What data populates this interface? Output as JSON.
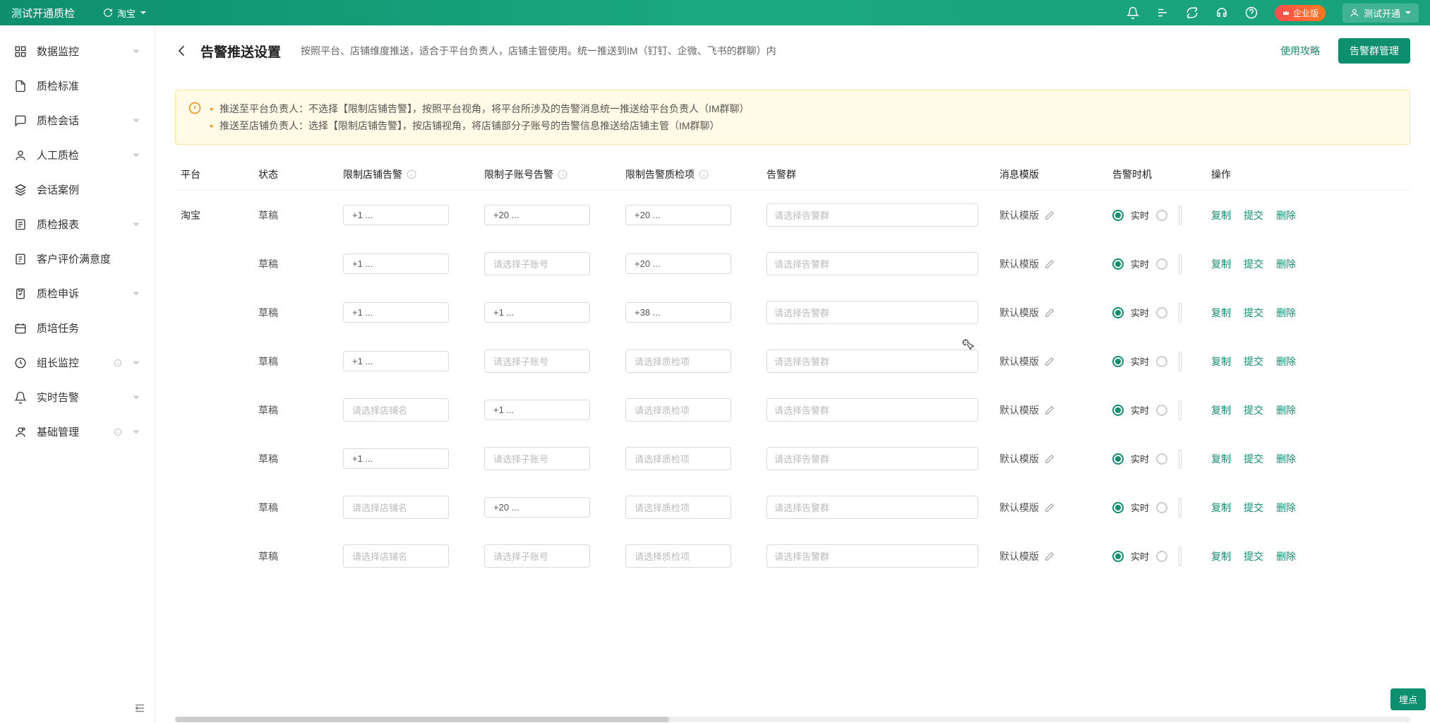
{
  "header": {
    "app_title": "测试开通质检",
    "platform_select": "淘宝",
    "enterprise_badge": "企业版",
    "user_label": "测试开通"
  },
  "sidebar": {
    "items": [
      {
        "label": "数据监控",
        "icon": "dashboard-icon",
        "expandable": true
      },
      {
        "label": "质检标准",
        "icon": "file-icon",
        "expandable": false
      },
      {
        "label": "质检会话",
        "icon": "chat-icon",
        "expandable": true
      },
      {
        "label": "人工质检",
        "icon": "person-icon",
        "expandable": true
      },
      {
        "label": "会话案例",
        "icon": "layers-icon",
        "expandable": false
      },
      {
        "label": "质检报表",
        "icon": "report-icon",
        "expandable": true
      },
      {
        "label": "客户评价满意度",
        "icon": "survey-icon",
        "expandable": false
      },
      {
        "label": "质检申诉",
        "icon": "appeal-icon",
        "expandable": true
      },
      {
        "label": "质培任务",
        "icon": "task-icon",
        "expandable": false
      },
      {
        "label": "组长监控",
        "icon": "clock-icon",
        "expandable": true,
        "info": true
      },
      {
        "label": "实时告警",
        "icon": "bell-icon",
        "expandable": true
      },
      {
        "label": "基础管理",
        "icon": "admin-icon",
        "expandable": true,
        "info": true
      }
    ]
  },
  "page": {
    "title": "告警推送设置",
    "desc": "按照平台、店铺维度推送，适合于平台负责人，店铺主管使用。统一推送到IM（钉钉、企微、飞书的群聊）内",
    "guide_btn": "使用攻略",
    "manage_btn": "告警群管理"
  },
  "alert": {
    "line1": "推送至平台负责人：不选择【限制店铺告警】，按照平台视角，将平台所涉及的告警消息统一推送给平台负责人（IM群聊）",
    "line2": "推送至店铺负责人：选择【限制店铺告警】，按店铺视角，将店铺部分子账号的告警信息推送给店铺主管（IM群聊）"
  },
  "table": {
    "columns": {
      "platform": "平台",
      "status": "状态",
      "shop_limit": "限制店铺告警",
      "sub_limit": "限制子账号告警",
      "check_limit": "限制告警质检项",
      "group": "告警群",
      "template": "消息模版",
      "timing": "告警时机",
      "action": "操作"
    },
    "placeholders": {
      "shop": "请选择店铺名",
      "sub": "请选择子账号",
      "check": "请选择质检项",
      "group": "请选择告警群"
    },
    "template_default": "默认模版",
    "timing_realtime": "实时",
    "actions": {
      "copy": "复制",
      "submit": "提交",
      "delete": "删除"
    },
    "rows": [
      {
        "platform": "淘宝",
        "status": "草稿",
        "shop": "+1 ...",
        "sub": "+20 ...",
        "check": "+20 ...",
        "group": ""
      },
      {
        "platform": "",
        "status": "草稿",
        "shop": "+1 ...",
        "sub": "",
        "check": "+20 ...",
        "group": ""
      },
      {
        "platform": "",
        "status": "草稿",
        "shop": "+1 ...",
        "sub": "+1 ...",
        "check": "+38 ...",
        "group": ""
      },
      {
        "platform": "",
        "status": "草稿",
        "shop": "+1 ...",
        "sub": "",
        "check": "",
        "group": ""
      },
      {
        "platform": "",
        "status": "草稿",
        "shop": "",
        "sub": "+1 ...",
        "check": "",
        "group": ""
      },
      {
        "platform": "",
        "status": "草稿",
        "shop": "+1 ...",
        "sub": "",
        "check": "",
        "group": ""
      },
      {
        "platform": "",
        "status": "草稿",
        "shop": "",
        "sub": "+20 ...",
        "check": "",
        "group": ""
      },
      {
        "platform": "",
        "status": "草稿",
        "shop": "",
        "sub": "",
        "check": "",
        "group": ""
      }
    ]
  },
  "float_btn": "埋点"
}
